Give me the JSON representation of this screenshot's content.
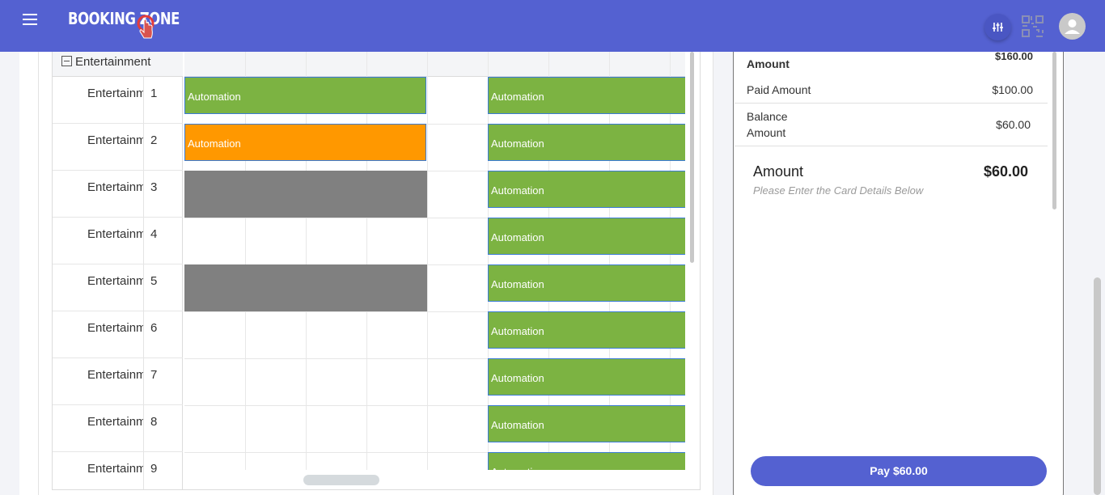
{
  "app": {
    "logo_text": "BOOKING ZONE"
  },
  "header": {
    "menu_icon": "hamburger-menu-icon",
    "filter_icon": "sliders-icon",
    "scan_icon": "qr-scan-icon",
    "avatar_icon": "user-avatar-icon"
  },
  "scheduler": {
    "group_label": "Entertainment",
    "resources": [
      {
        "name": "Entertainment",
        "number": "1"
      },
      {
        "name": "Entertainment",
        "number": "2"
      },
      {
        "name": "Entertainment",
        "number": "3"
      },
      {
        "name": "Entertainment",
        "number": "4"
      },
      {
        "name": "Entertainment",
        "number": "5"
      },
      {
        "name": "Entertainment",
        "number": "6"
      },
      {
        "name": "Entertainment",
        "number": "7"
      },
      {
        "name": "Entertainment",
        "number": "8"
      },
      {
        "name": "Entertainment",
        "number": "9"
      }
    ],
    "events": [
      {
        "row": 0,
        "slot": "first",
        "label": "Automation",
        "color": "#7cb342"
      },
      {
        "row": 0,
        "slot": "second",
        "label": "Automation",
        "color": "#7cb342"
      },
      {
        "row": 1,
        "slot": "first",
        "label": "Automation",
        "color": "#ff9800"
      },
      {
        "row": 1,
        "slot": "second",
        "label": "Automation",
        "color": "#7cb342"
      },
      {
        "row": 2,
        "slot": "second",
        "label": "Automation",
        "color": "#7cb342"
      },
      {
        "row": 3,
        "slot": "second",
        "label": "Automation",
        "color": "#7cb342"
      },
      {
        "row": 4,
        "slot": "second",
        "label": "Automation",
        "color": "#7cb342"
      },
      {
        "row": 5,
        "slot": "second",
        "label": "Automation",
        "color": "#7cb342"
      },
      {
        "row": 6,
        "slot": "second",
        "label": "Automation",
        "color": "#7cb342"
      },
      {
        "row": 7,
        "slot": "second",
        "label": "Automation",
        "color": "#7cb342"
      },
      {
        "row": 8,
        "slot": "second",
        "label": "Automation",
        "color": "#7cb342"
      }
    ],
    "blocked_color": "#808080"
  },
  "payment": {
    "total_label": "Amount",
    "total_value": "$160.00",
    "paid_label": "Paid Amount",
    "paid_value": "$100.00",
    "balance_label_line1": "Balance",
    "balance_label_line2": "Amount",
    "balance_value": "$60.00",
    "amount_title": "Amount",
    "amount_value": "$60.00",
    "hint": "Please Enter the Card Details Below",
    "pay_button": "Pay $60.00"
  },
  "colors": {
    "brand": "#5461d1",
    "green": "#7cb342",
    "orange": "#ff9800"
  }
}
